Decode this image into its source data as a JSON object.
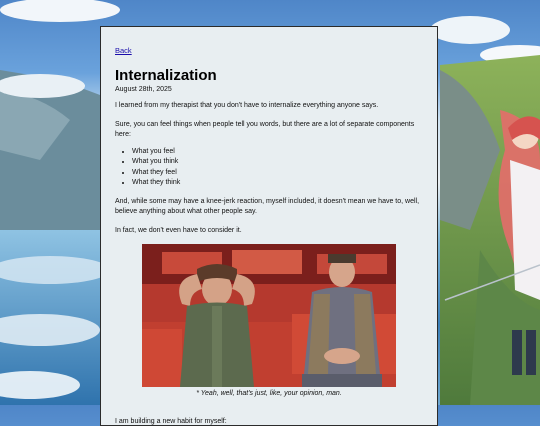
{
  "nav": {
    "back_label": "Back"
  },
  "post": {
    "title": "Internalization",
    "date": "August 28th, 2025",
    "paragraphs": [
      "I learned from my therapist that you don't have to internalize everything anyone says.",
      "Sure, you can feel things when people tell you words, but there are a lot of separate components here:",
      "And, while some may have a knee-jerk reaction, myself included, it doesn't mean we have to, well, believe anything about what other people say.",
      "In fact, we don't even have to consider it.",
      "I am building a new habit for myself:"
    ],
    "components": [
      "What you feel",
      "What you think",
      "What they feel",
      "What they think"
    ],
    "image_caption": "* Yeah, well, that's just, like, your opinion, man."
  }
}
